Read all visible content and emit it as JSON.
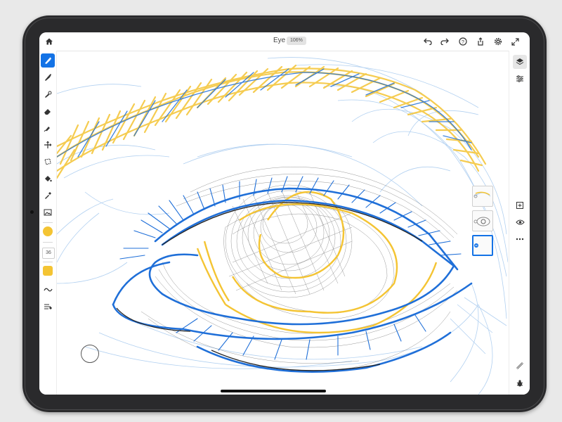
{
  "document": {
    "title": "Eye",
    "zoom": "106%"
  },
  "topbar": {
    "icons": [
      "home-icon",
      "undo-icon",
      "redo-icon",
      "help-icon",
      "share-icon",
      "settings-icon",
      "fullscreen-icon"
    ]
  },
  "toolbar": {
    "tools": [
      "select-brush-icon",
      "pixel-brush-icon",
      "vector-brush-icon",
      "eraser-icon",
      "smudge-icon",
      "transform-icon",
      "lasso-icon",
      "fill-icon",
      "eyedropper-icon",
      "image-icon"
    ],
    "active_tool": "select-brush-icon",
    "brush_size": "36",
    "color": "#f4c433"
  },
  "rightbar": {
    "icons": [
      "layers-icon",
      "layer-properties-icon",
      "add-layer-icon",
      "visibility-icon",
      "more-icon",
      "ruler-icon",
      "bug-icon"
    ]
  },
  "layers": [
    {
      "name": "layer-1"
    },
    {
      "name": "layer-2"
    },
    {
      "name": "layer-3",
      "active": true
    }
  ],
  "colors": {
    "accent": "#1473e6",
    "yellow": "#f4c433",
    "sketch_blue": "#1f6fd8",
    "light_blue": "#a9cbef"
  }
}
